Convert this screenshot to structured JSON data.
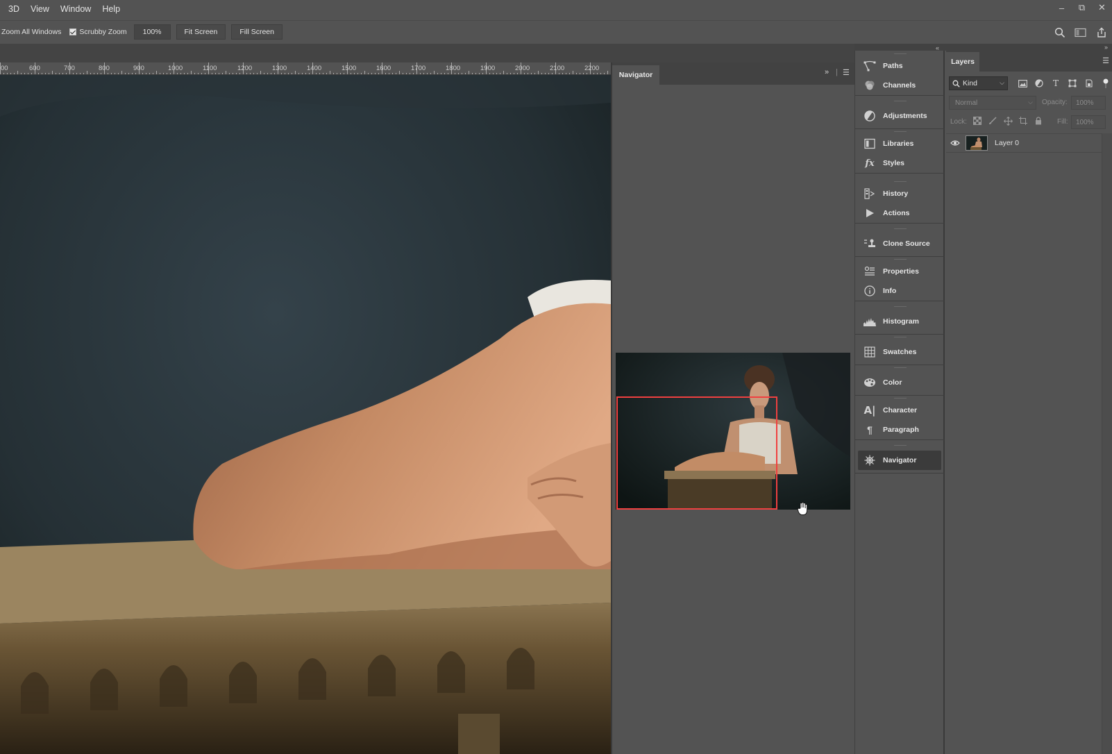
{
  "menubar": {
    "items": [
      "3D",
      "View",
      "Window",
      "Help"
    ]
  },
  "window_controls": {
    "minimize": "–",
    "restore": "⧉",
    "close": "✕"
  },
  "options_bar": {
    "zoom_all_windows": "Zoom All Windows",
    "scrubby_zoom_label": "Scrubby Zoom",
    "scrubby_zoom_checked": true,
    "zoom_value": "100%",
    "fit_screen": "Fit Screen",
    "fill_screen": "Fill Screen"
  },
  "ruler": {
    "labels": [
      "700",
      "800",
      "900",
      "1000",
      "1100",
      "1200",
      "1300",
      "1400",
      "1500",
      "1600",
      "1700",
      "1800",
      "1900",
      "2000",
      "2100",
      "2200"
    ],
    "partial_labels": [
      "00",
      "600"
    ]
  },
  "navigator": {
    "tab_label": "Navigator"
  },
  "dock": {
    "groups": [
      [
        "Paths",
        "Channels"
      ],
      [
        "Adjustments"
      ],
      [
        "Libraries",
        "Styles"
      ],
      [
        "History",
        "Actions"
      ],
      [
        "Clone Source"
      ],
      [
        "Properties",
        "Info"
      ],
      [
        "Histogram"
      ],
      [
        "Swatches"
      ],
      [
        "Color"
      ],
      [
        "Character",
        "Paragraph"
      ],
      [
        "Navigator"
      ]
    ],
    "active": "Navigator"
  },
  "layers": {
    "tab_label": "Layers",
    "kind_filter": "Kind",
    "blend_mode": "Normal",
    "opacity_label": "Opacity:",
    "opacity_value": "100%",
    "lock_label": "Lock:",
    "fill_label": "Fill:",
    "fill_value": "100%",
    "items": [
      {
        "name": "Layer 0",
        "visible": true
      }
    ]
  },
  "colors": {
    "ui_bg": "#535353",
    "ui_dark": "#424242",
    "navigator_view_box": "#f04040"
  }
}
